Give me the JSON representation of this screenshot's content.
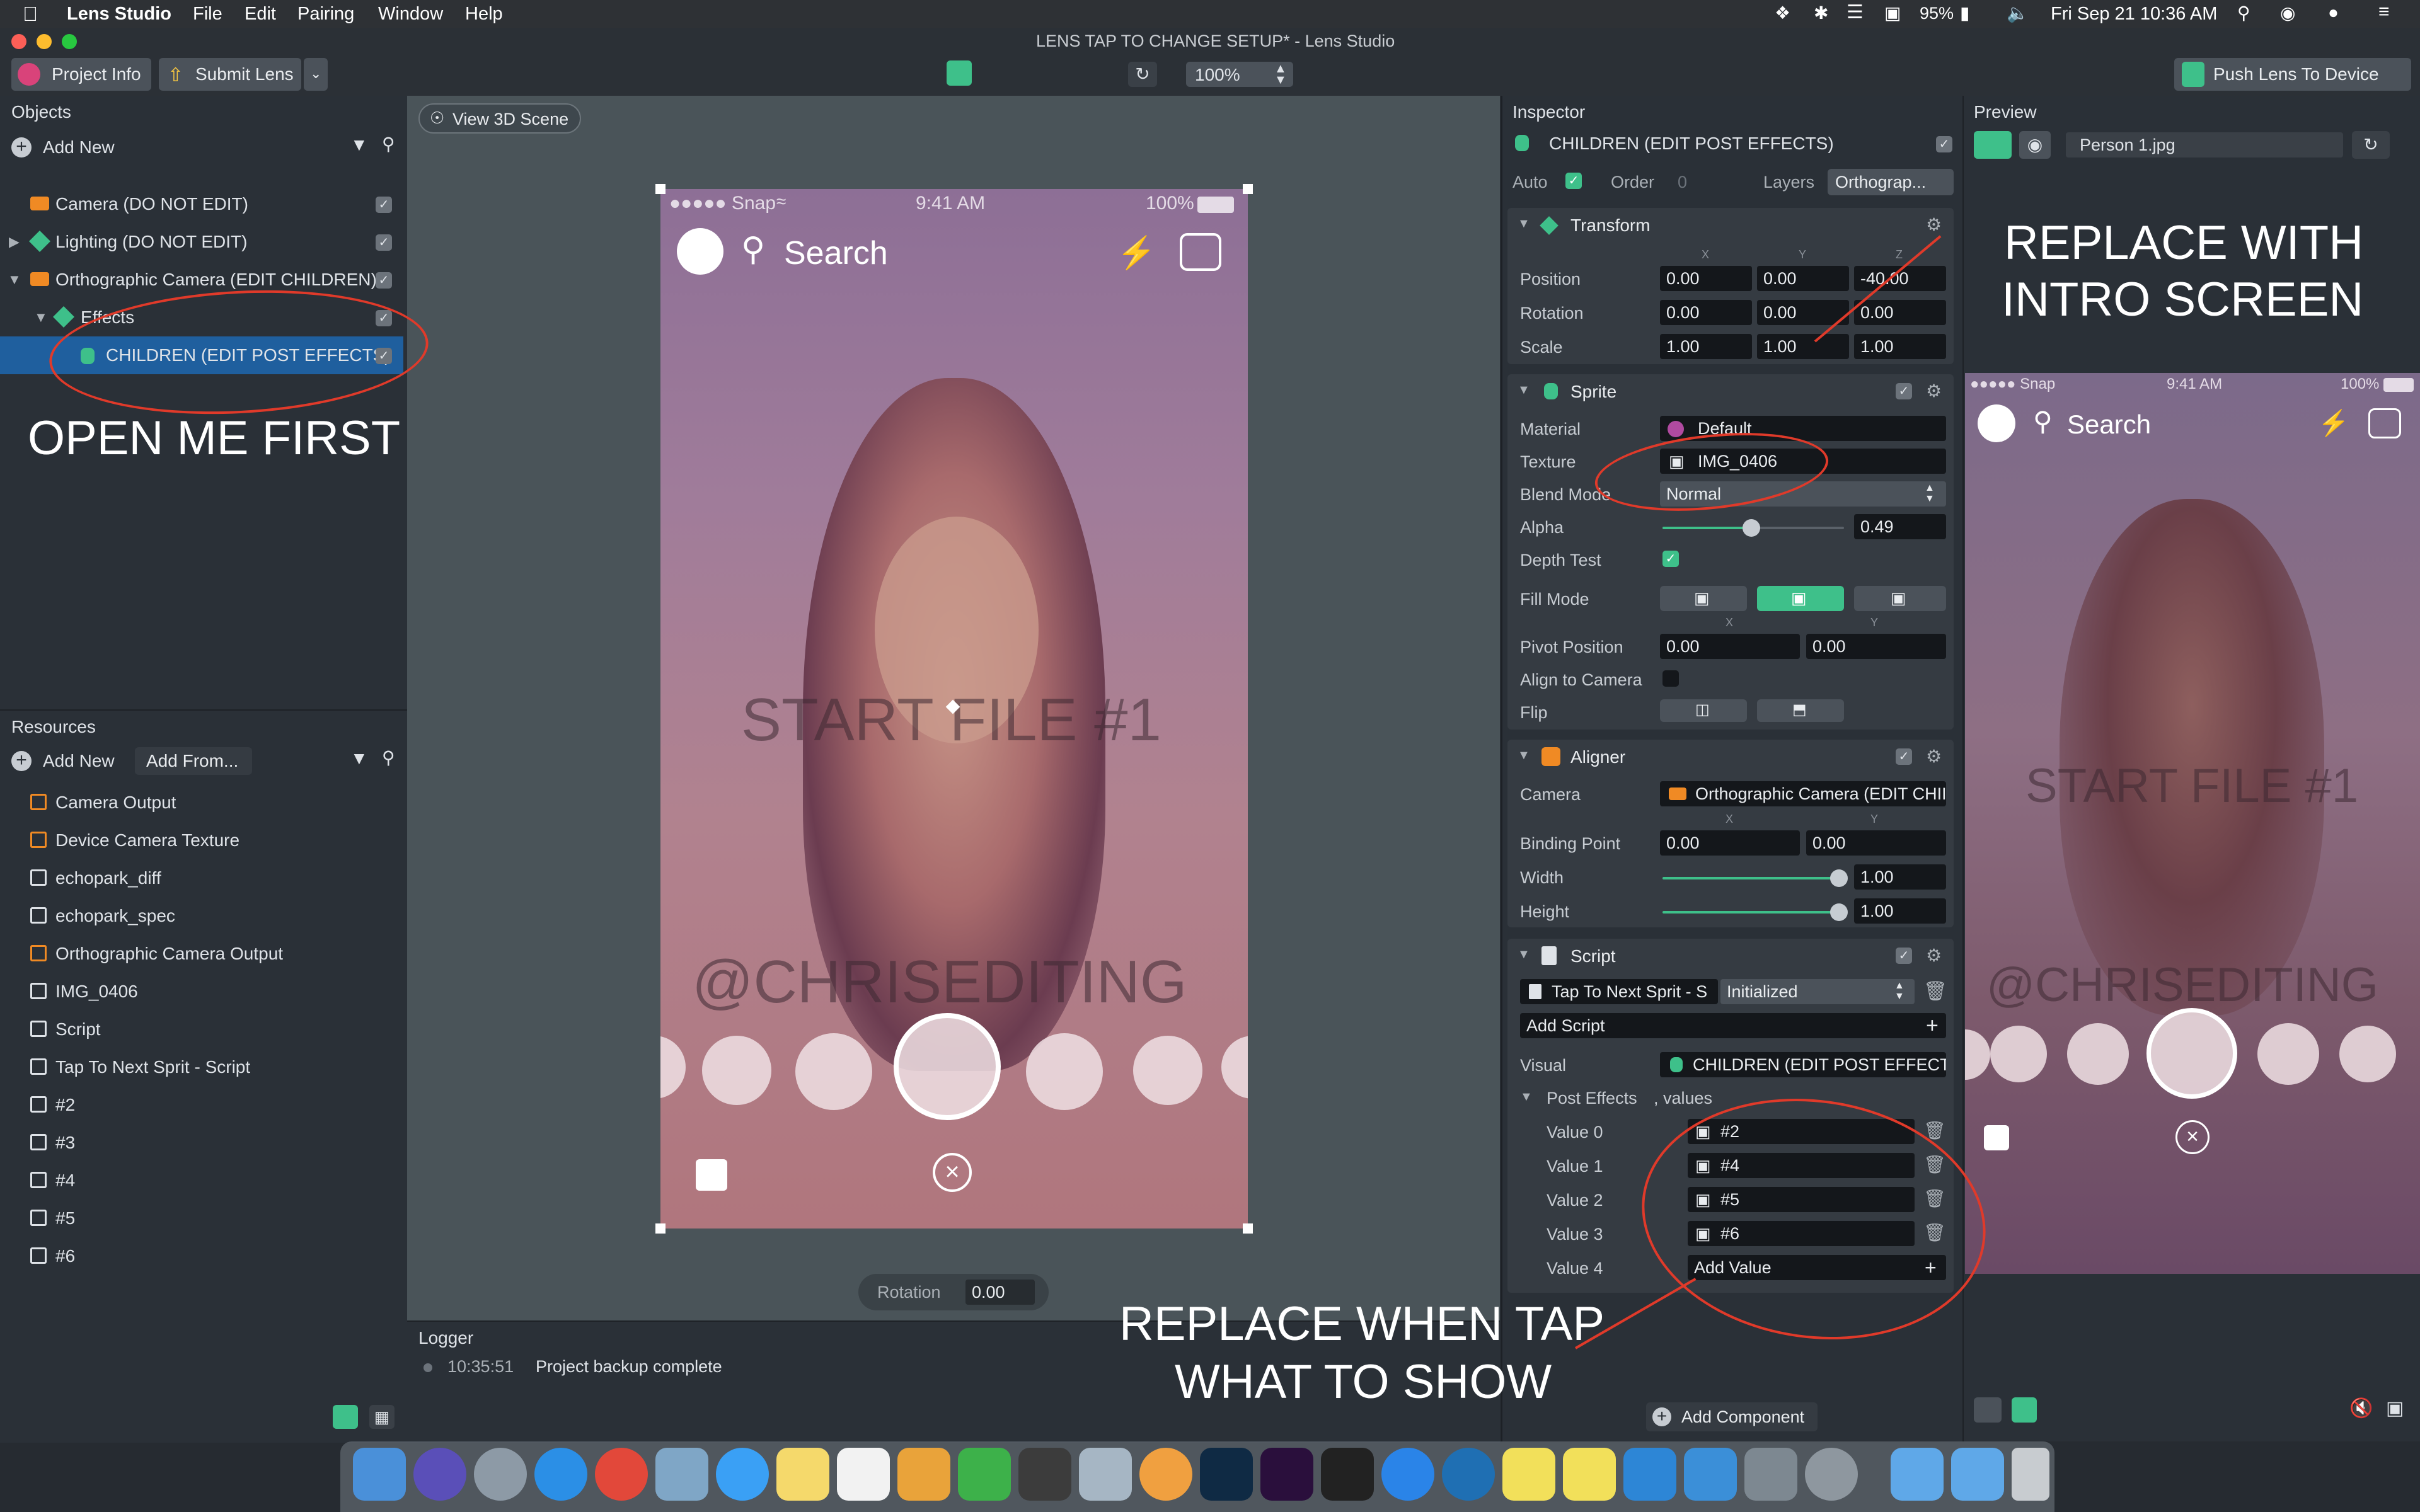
{
  "menubar": {
    "app": "Lens Studio",
    "items": [
      "File",
      "Edit",
      "Pairing",
      "Window",
      "Help"
    ],
    "battery": "95%",
    "datetime": "Fri Sep 21  10:36 AM"
  },
  "window": {
    "title": "LENS TAP TO CHANGE SETUP* - Lens Studio"
  },
  "toolbar": {
    "project_info": "Project Info",
    "submit_lens": "Submit Lens",
    "zoom": "100%",
    "push_lens": "Push Lens To Device"
  },
  "objects": {
    "title": "Objects",
    "add_new": "Add New",
    "items": [
      {
        "label": "Camera (DO NOT EDIT)"
      },
      {
        "label": "Lighting (DO NOT EDIT)"
      },
      {
        "label": "Orthographic Camera (EDIT CHILDREN)"
      },
      {
        "label": "Effects"
      },
      {
        "label": "CHILDREN (EDIT POST EFFECTS)"
      }
    ],
    "annotation": "OPEN ME FIRST"
  },
  "resources": {
    "title": "Resources",
    "add_new": "Add New",
    "add_from": "Add From...",
    "items": [
      {
        "label": "Camera Output"
      },
      {
        "label": "Device Camera Texture"
      },
      {
        "label": "echopark_diff"
      },
      {
        "label": "echopark_spec"
      },
      {
        "label": "Orthographic Camera Output"
      },
      {
        "label": "IMG_0406"
      },
      {
        "label": "Script"
      },
      {
        "label": "Tap To Next Sprit - Script"
      },
      {
        "label": "#2"
      },
      {
        "label": "#3"
      },
      {
        "label": "#4"
      },
      {
        "label": "#5"
      },
      {
        "label": "#6"
      }
    ]
  },
  "scene": {
    "view3d": "View 3D Scene",
    "rotation_label": "Rotation",
    "rotation_value": "0.00",
    "phone": {
      "carrier": "●●●●● Snap",
      "time": "9:41 AM",
      "battery": "100%",
      "search": "Search",
      "overlay1": "START FILE #1",
      "overlay2": "@CHRISEDITING"
    }
  },
  "logger": {
    "title": "Logger",
    "time": "10:35:51",
    "message": "Project backup complete",
    "annotation_line1": "REPLACE WHEN TAP",
    "annotation_line2": "WHAT TO SHOW"
  },
  "inspector": {
    "title": "Inspector",
    "object_name": "CHILDREN (EDIT POST EFFECTS)",
    "auto": "Auto",
    "order": "Order",
    "order_value": "0",
    "layers": "Layers",
    "layers_value": "Orthograp...",
    "transform": {
      "title": "Transform",
      "axis_x": "X",
      "axis_y": "Y",
      "axis_z": "Z",
      "position_label": "Position",
      "position": [
        "0.00",
        "0.00",
        "-40.00"
      ],
      "rotation_label": "Rotation",
      "rotation": [
        "0.00",
        "0.00",
        "0.00"
      ],
      "scale_label": "Scale",
      "scale": [
        "1.00",
        "1.00",
        "1.00"
      ]
    },
    "sprite": {
      "title": "Sprite",
      "material_label": "Material",
      "material": "Default",
      "texture_label": "Texture",
      "texture": "IMG_0406",
      "blend_label": "Blend Mode",
      "blend": "Normal",
      "alpha_label": "Alpha",
      "alpha": "0.49",
      "alpha_level": 0.49,
      "depth_label": "Depth Test",
      "fill_label": "Fill Mode",
      "pivot_label": "Pivot Position",
      "pivot": [
        "0.00",
        "0.00"
      ],
      "align_label": "Align to Camera",
      "flip_label": "Flip",
      "axis_x": "X",
      "axis_y": "Y"
    },
    "aligner": {
      "title": "Aligner",
      "camera_label": "Camera",
      "camera": "Orthographic Camera (EDIT CHII",
      "binding_label": "Binding Point",
      "binding": [
        "0.00",
        "0.00"
      ],
      "width_label": "Width",
      "width": "1.00",
      "height_label": "Height",
      "height": "1.00",
      "axis_x": "X",
      "axis_y": "Y"
    },
    "script": {
      "title": "Script",
      "script_name": "Tap To Next Sprit - S",
      "state": "Initialized",
      "add_script": "Add Script",
      "visual_label": "Visual",
      "visual": "CHILDREN (EDIT POST EFFECTS",
      "post_effects_label": "Post Effects",
      "post_effects_suffix": ", values",
      "values": [
        {
          "label": "Value 0",
          "value": "#2"
        },
        {
          "label": "Value 1",
          "value": "#4"
        },
        {
          "label": "Value 2",
          "value": "#5"
        },
        {
          "label": "Value 3",
          "value": "#6"
        }
      ],
      "value4_label": "Value 4",
      "add_value": "Add Value"
    },
    "add_component": "Add Component"
  },
  "preview": {
    "title": "Preview",
    "file": "Person 1.jpg",
    "annotation_line1": "REPLACE WITH",
    "annotation_line2": "INTRO SCREEN",
    "phone": {
      "carrier": "●●●●● Snap",
      "time": "9:41 AM",
      "battery": "100%",
      "search": "Search",
      "overlay1": "START FILE #1",
      "overlay2": "@CHRISEDITING"
    }
  },
  "colors": {
    "accent": "#3ec08a",
    "annotation": "#e03a2a",
    "selection": "#1f5f9e"
  }
}
